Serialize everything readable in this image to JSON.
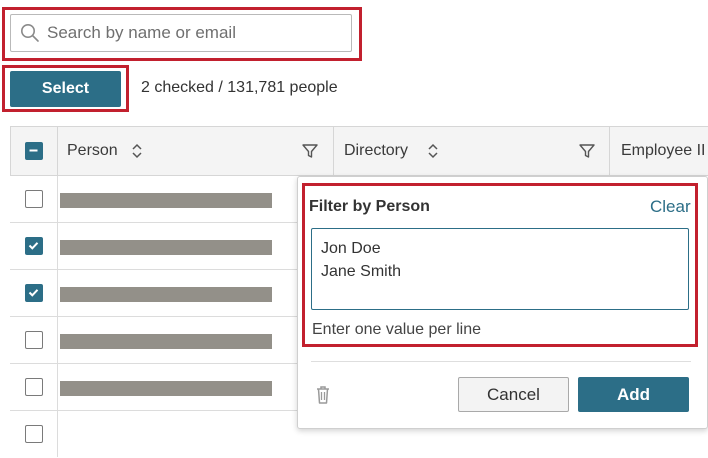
{
  "search": {
    "placeholder": "Search by name or email",
    "value": ""
  },
  "toolbar": {
    "select_label": "Select",
    "selection_count": "2 checked / 131,781 people"
  },
  "table": {
    "columns": [
      {
        "label": "Person",
        "sortable": true,
        "filterable": true
      },
      {
        "label": "Directory",
        "sortable": true,
        "filterable": true
      },
      {
        "label": "Employee II",
        "sortable": false,
        "filterable": false
      }
    ],
    "rows": [
      {
        "checked": false
      },
      {
        "checked": true
      },
      {
        "checked": true
      },
      {
        "checked": false
      },
      {
        "checked": false
      }
    ]
  },
  "filter_popover": {
    "title": "Filter by Person",
    "clear_label": "Clear",
    "lines": [
      "Jon Doe",
      "Jane Smith"
    ],
    "hint": "Enter one value per line",
    "cancel_label": "Cancel",
    "add_label": "Add"
  },
  "colors": {
    "accent": "#2c6e87",
    "highlight": "#c2202e"
  }
}
